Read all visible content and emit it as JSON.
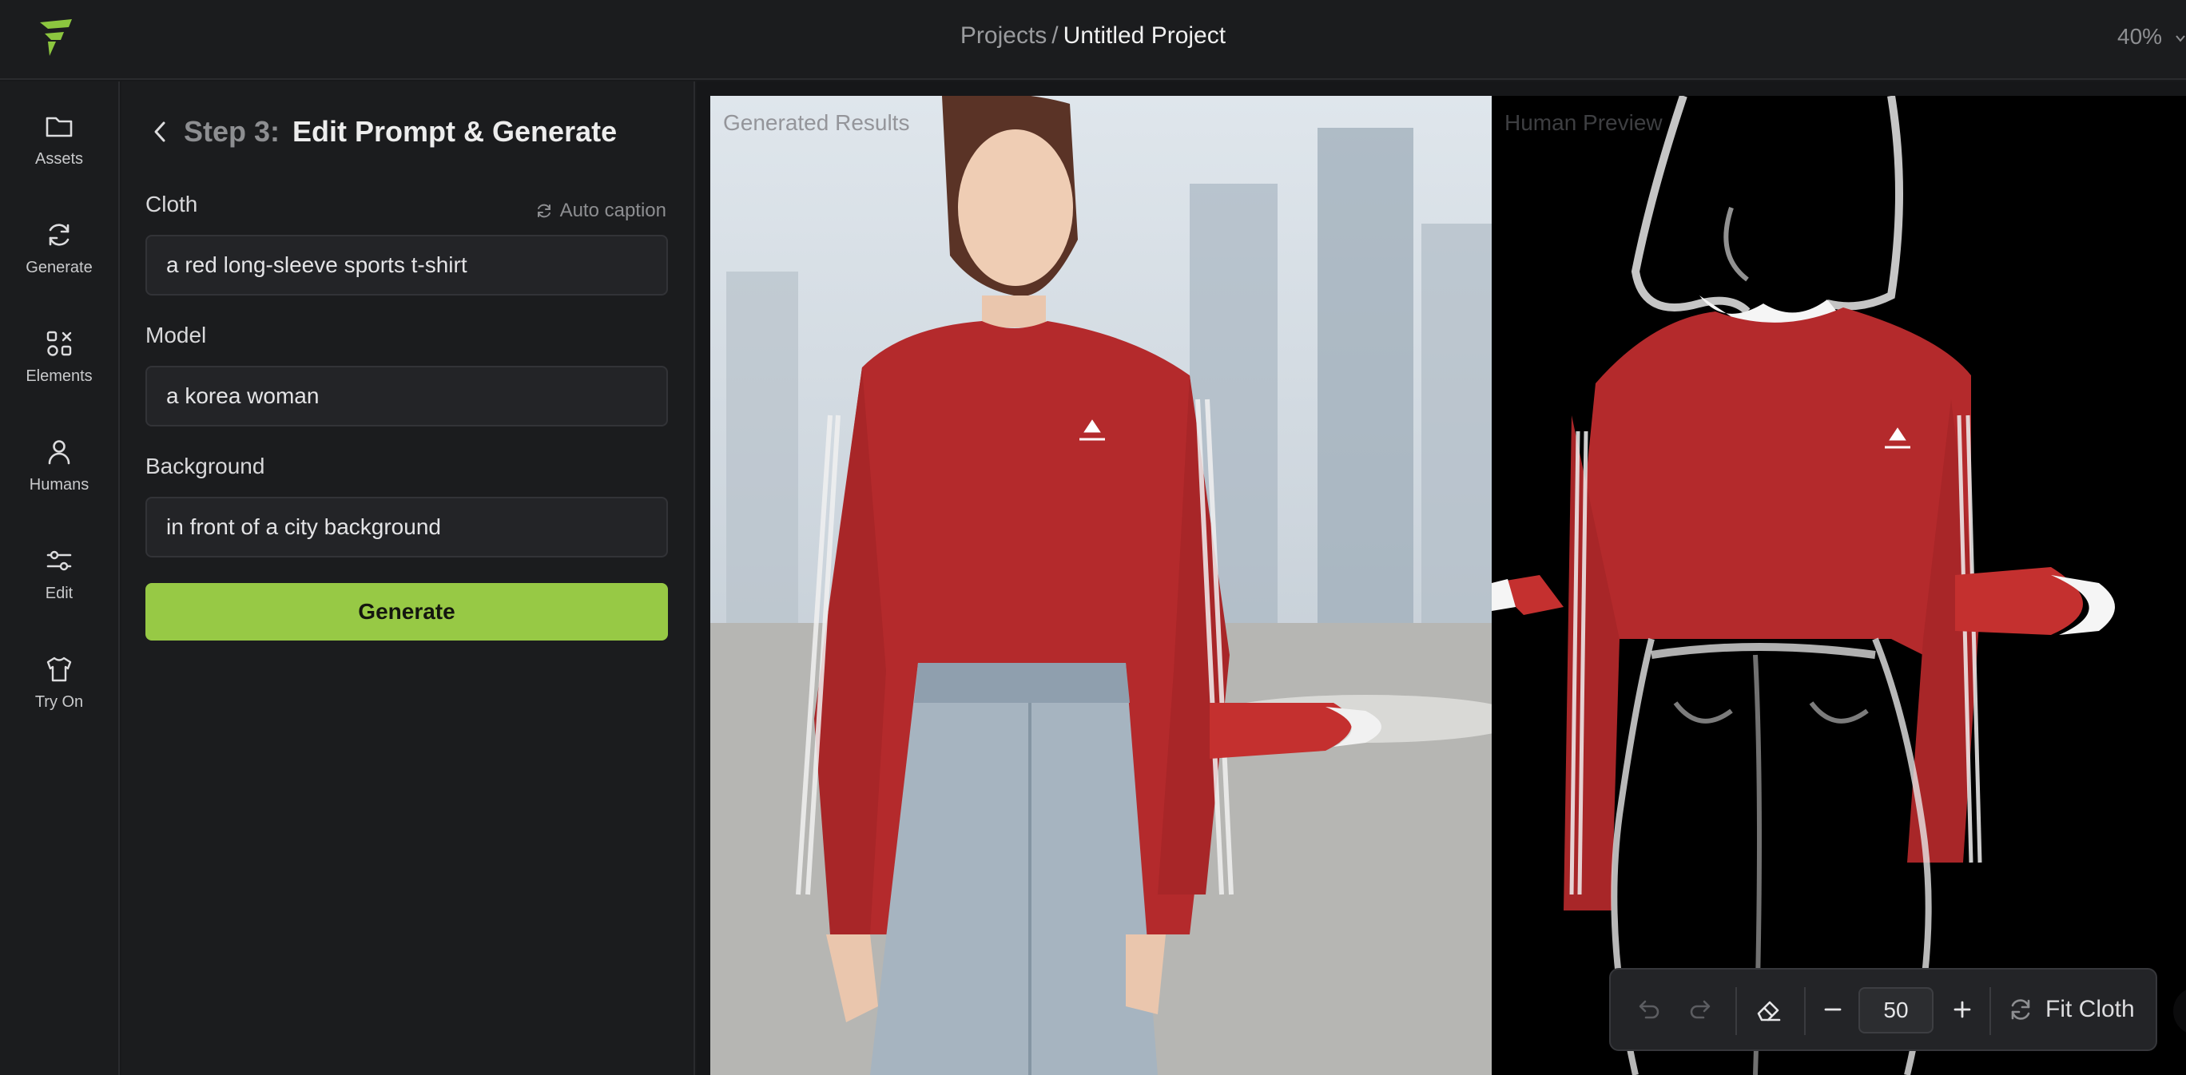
{
  "header": {
    "breadcrumb_root": "Projects",
    "breadcrumb_sep": "/",
    "breadcrumb_current": "Untitled Project",
    "zoom_label": "40%"
  },
  "sidebar": {
    "items": [
      {
        "label": "Assets",
        "icon": "folder-icon"
      },
      {
        "label": "Generate",
        "icon": "refresh-icon"
      },
      {
        "label": "Elements",
        "icon": "shapes-icon"
      },
      {
        "label": "Humans",
        "icon": "person-icon"
      },
      {
        "label": "Edit",
        "icon": "sliders-icon"
      },
      {
        "label": "Try On",
        "icon": "tshirt-icon"
      }
    ]
  },
  "panel": {
    "step_number": "Step 3:",
    "step_title": "Edit Prompt & Generate",
    "auto_caption": "Auto caption",
    "fields": [
      {
        "label": "Cloth",
        "value": "a red long-sleeve sports t-shirt"
      },
      {
        "label": "Model",
        "value": "a korea woman"
      },
      {
        "label": "Background",
        "value": "in front of a city background"
      }
    ],
    "generate_label": "Generate"
  },
  "canvas": {
    "result_label": "Generated Results",
    "preview_label": "Human Preview"
  },
  "toolbar": {
    "brush_size": "50",
    "fit_cloth_label": "Fit Cloth"
  },
  "colors": {
    "accent": "#97c945",
    "background": "#18191b",
    "panel": "#1b1c1e",
    "shirt_red": "#b42a2c"
  }
}
